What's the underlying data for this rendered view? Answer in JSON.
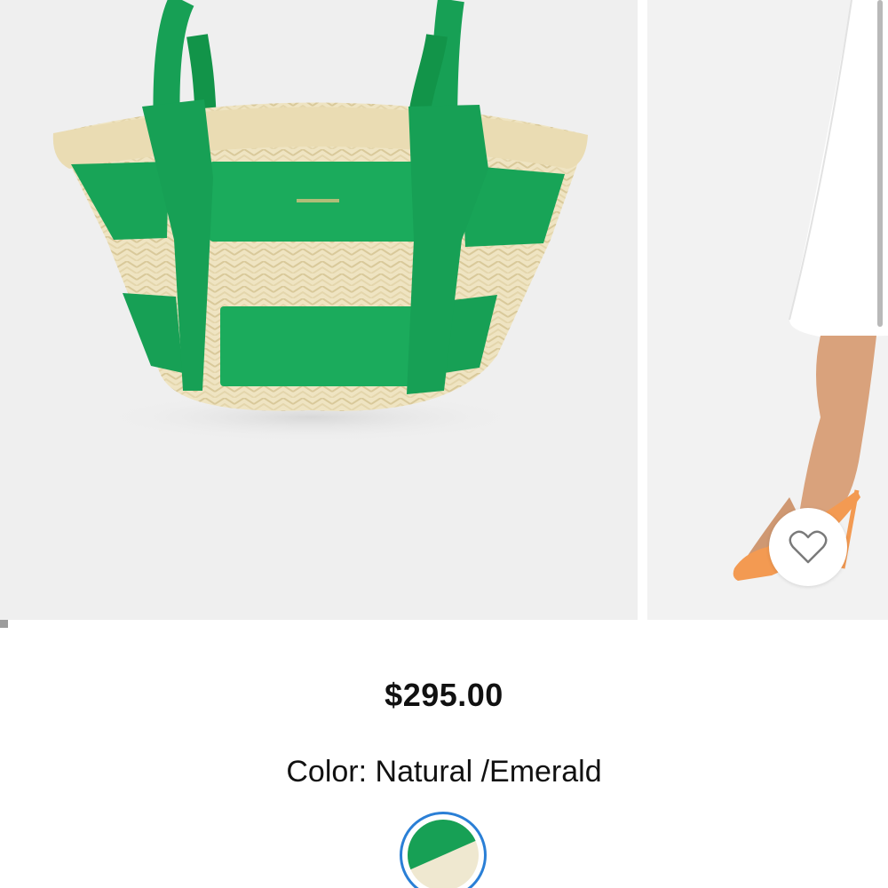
{
  "product": {
    "price": "$295.00",
    "color_label": "Color:",
    "color_value": "Natural /Emerald",
    "swatches": [
      {
        "name": "Natural /Emerald",
        "selected": true,
        "colors": [
          "#17a055",
          "#efe8d0"
        ]
      }
    ]
  },
  "gallery": {
    "images": [
      {
        "subject": "straw basket tote with emerald leather straps"
      },
      {
        "subject": "model wearing white skirt and orange mule sandals"
      }
    ],
    "current_index": 1,
    "favorite_icon": "heart-outline-icon"
  },
  "colors": {
    "emerald": "#17a055",
    "straw": "#efe4c2",
    "selected_ring": "#2a7fd6",
    "text": "#111111"
  }
}
